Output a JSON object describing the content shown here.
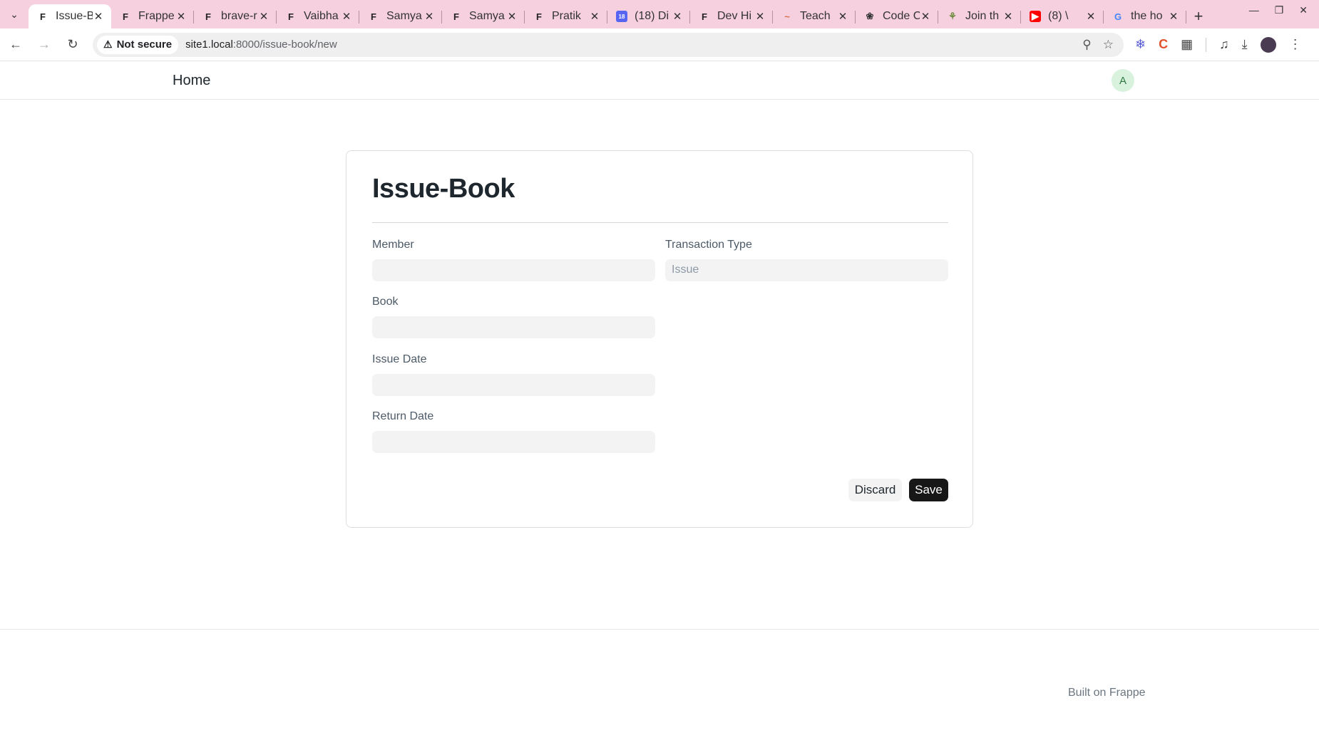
{
  "browser": {
    "tabs": [
      {
        "title": "Issue-B",
        "favicon": "frappe",
        "active": true
      },
      {
        "title": "Frappe",
        "favicon": "frappe",
        "active": false
      },
      {
        "title": "brave-r",
        "favicon": "frappe",
        "active": false
      },
      {
        "title": "Vaibha",
        "favicon": "frappe",
        "active": false
      },
      {
        "title": "Samya",
        "favicon": "frappe",
        "active": false
      },
      {
        "title": "Samya",
        "favicon": "frappe",
        "active": false
      },
      {
        "title": "Pratik",
        "favicon": "frappe",
        "active": false
      },
      {
        "title": "(18) Di",
        "favicon": "discord",
        "active": false
      },
      {
        "title": "Dev Hi",
        "favicon": "frappe",
        "active": false
      },
      {
        "title": "Teach",
        "favicon": "teach",
        "active": false
      },
      {
        "title": "Code C",
        "favicon": "openai",
        "active": false
      },
      {
        "title": "Join th",
        "favicon": "join",
        "active": false
      },
      {
        "title": "(8) \\",
        "favicon": "youtube",
        "active": false
      },
      {
        "title": "the ho",
        "favicon": "google",
        "active": false
      }
    ],
    "security_label": "Not secure",
    "url_host": "site1.local",
    "url_path": ":8000/issue-book/new"
  },
  "navbar": {
    "brand": "Home",
    "avatar_initial": "A"
  },
  "form": {
    "title": "Issue-Book",
    "fields": {
      "member": {
        "label": "Member",
        "value": ""
      },
      "transaction_type": {
        "label": "Transaction Type",
        "value": "Issue"
      },
      "book": {
        "label": "Book",
        "value": ""
      },
      "issue_date": {
        "label": "Issue Date",
        "value": ""
      },
      "return_date": {
        "label": "Return Date",
        "value": ""
      }
    },
    "discard_label": "Discard",
    "save_label": "Save"
  },
  "footer": {
    "built_on": "Built on Frappe"
  },
  "colors": {
    "tabbar": "#f7d0df",
    "save_button": "#171717",
    "avatar_bg": "#d8f2de"
  }
}
